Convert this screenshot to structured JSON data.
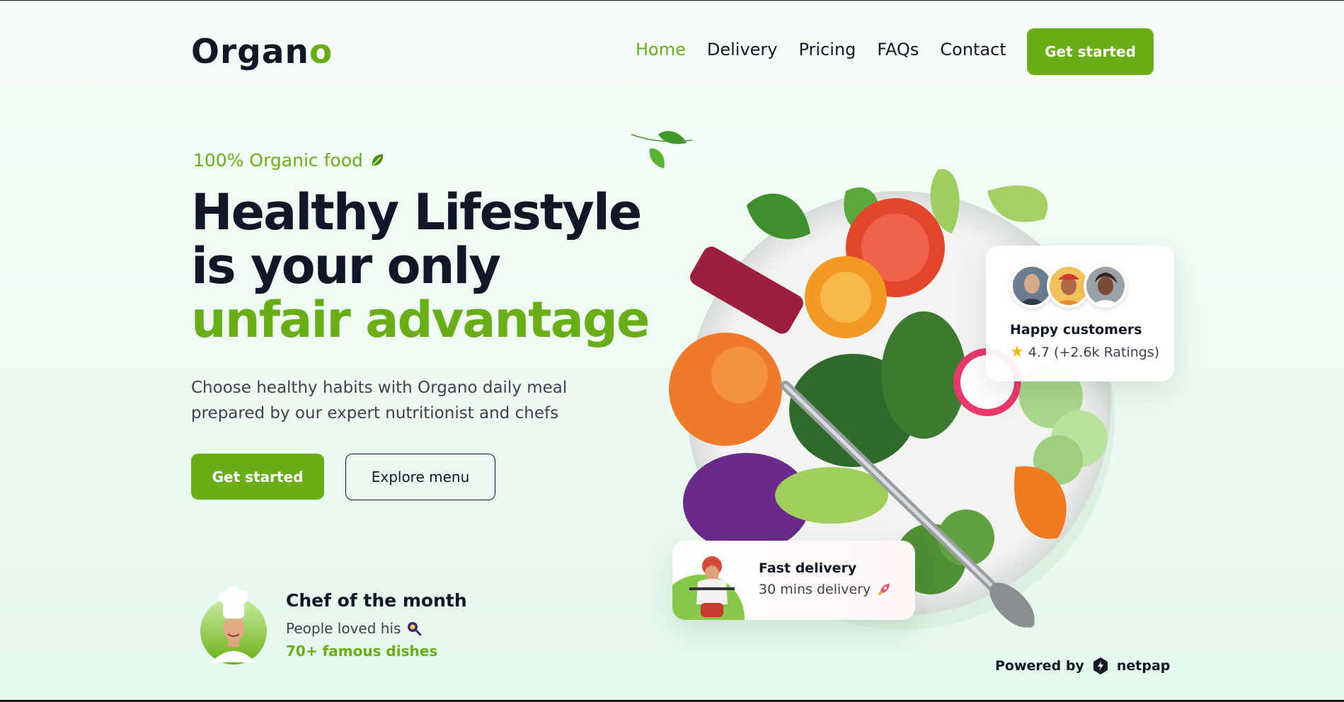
{
  "brand": {
    "logo_main": "Organ",
    "logo_accent": "o"
  },
  "nav": {
    "items": [
      "Home",
      "Delivery",
      "Pricing",
      "FAQs",
      "Contact"
    ],
    "active": "Home",
    "cta": "Get started"
  },
  "hero": {
    "tagline": "100% Organic food",
    "headline_line1": "Healthy Lifestyle",
    "headline_line2": "is your only",
    "headline_line3": "unfair advantage",
    "description": "Choose healthy habits with Organo daily meal prepared by our expert nutritionist and chefs",
    "primary_button": "Get started",
    "secondary_button": "Explore menu"
  },
  "chef": {
    "title": "Chef of the month",
    "subtitle": "People loved his",
    "dishes": "70+ famous dishes"
  },
  "happy_customers": {
    "title": "Happy customers",
    "rating": "4.7 (+2.6k Ratings)"
  },
  "fast_delivery": {
    "title": "Fast delivery",
    "subtitle": "30 mins delivery"
  },
  "powered": {
    "label": "Powered by",
    "brand": "netpap"
  },
  "colors": {
    "accent": "#6aae17",
    "text": "#101828"
  }
}
